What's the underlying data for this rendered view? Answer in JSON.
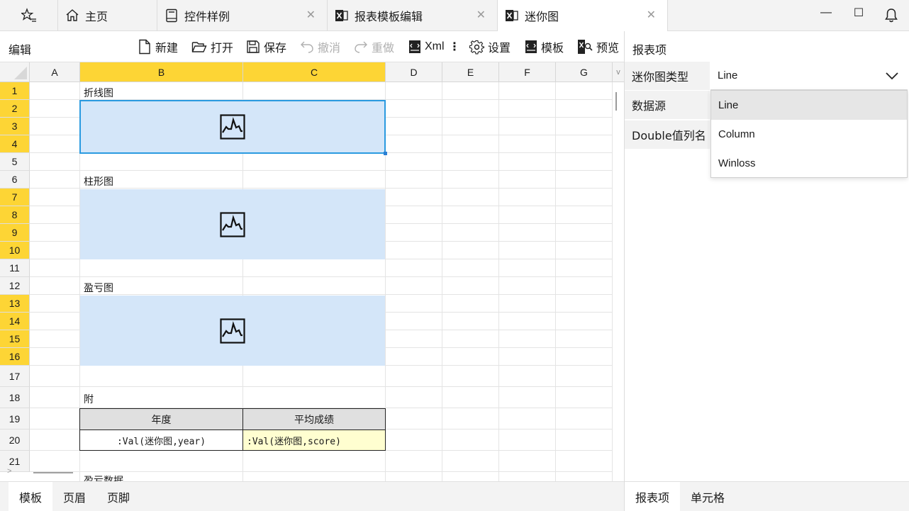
{
  "titlebar": {
    "pin_icon": "star-list-icon",
    "tabs": [
      {
        "label": "主页",
        "icon": "home-icon",
        "closable": false
      },
      {
        "label": "控件样例",
        "icon": "book-icon",
        "closable": true
      },
      {
        "label": "报表模板编辑",
        "icon": "excel-icon",
        "closable": true
      },
      {
        "label": "迷你图",
        "icon": "excel-icon",
        "closable": true,
        "active": true
      }
    ],
    "close_glyph": "✕",
    "window": {
      "minimize": "—",
      "maximize": "☐",
      "notify_icon": "bell-icon"
    }
  },
  "toolbar": {
    "title": "编辑",
    "items": [
      {
        "label": "新建",
        "icon": "new-file-icon",
        "enabled": true
      },
      {
        "label": "打开",
        "icon": "folder-open-icon",
        "enabled": true
      },
      {
        "label": "保存",
        "icon": "save-icon",
        "enabled": true
      },
      {
        "label": "撤消",
        "icon": "undo-icon",
        "enabled": false
      },
      {
        "label": "重做",
        "icon": "redo-icon",
        "enabled": false
      },
      {
        "label": "Xml",
        "icon": "xml-icon",
        "enabled": true
      },
      {
        "label": "设置",
        "icon": "gear-icon",
        "enabled": true
      },
      {
        "label": "模板",
        "icon": "template-icon",
        "enabled": true
      },
      {
        "label": "预览",
        "icon": "preview-icon",
        "enabled": true
      }
    ],
    "more_glyph": "⋮"
  },
  "sheet": {
    "columns": [
      "A",
      "B",
      "C",
      "D",
      "E",
      "F",
      "G"
    ],
    "selected_columns": [
      "B",
      "C"
    ],
    "col_overflow": "v",
    "rows": [
      "1",
      "2",
      "3",
      "4",
      "5",
      "6",
      "7",
      "8",
      "9",
      "10",
      "11",
      "12",
      "13",
      "14",
      "15",
      "16",
      "17",
      "18",
      "19",
      "20",
      "21"
    ],
    "selected_rows": [
      "1",
      "2",
      "3",
      "4",
      "7",
      "8",
      "9",
      "10",
      "13",
      "14",
      "15",
      "16"
    ],
    "labels": {
      "line": "折线图",
      "column": "柱形图",
      "winloss": "盈亏图",
      "appendix": "附",
      "partial": "盈亏数据"
    },
    "sparkline_icon": "sparkline-chart-icon",
    "table": {
      "headers": [
        "年度",
        "平均成绩"
      ],
      "row": [
        ":Val(迷你图,year)",
        ":Val(迷你图,score)"
      ]
    },
    "scroll_arrow": ">"
  },
  "bottom_tabs": [
    "模板",
    "页眉",
    "页脚"
  ],
  "panel": {
    "title": "报表项",
    "fields": [
      "迷你图类型",
      "数据源",
      "Double值列名"
    ],
    "sparkline_type": {
      "value": "Line",
      "options": [
        "Line",
        "Column",
        "Winloss"
      ],
      "highlighted": "Line"
    },
    "bottom_tabs": [
      "报表项",
      "单元格"
    ]
  },
  "colors": {
    "selection_header": "#fdd535",
    "merged_cell": "#d4e6f9",
    "selection_border": "#2a9ae0",
    "table_header": "#e0e0e0",
    "highlight_cell": "#fffed0"
  }
}
